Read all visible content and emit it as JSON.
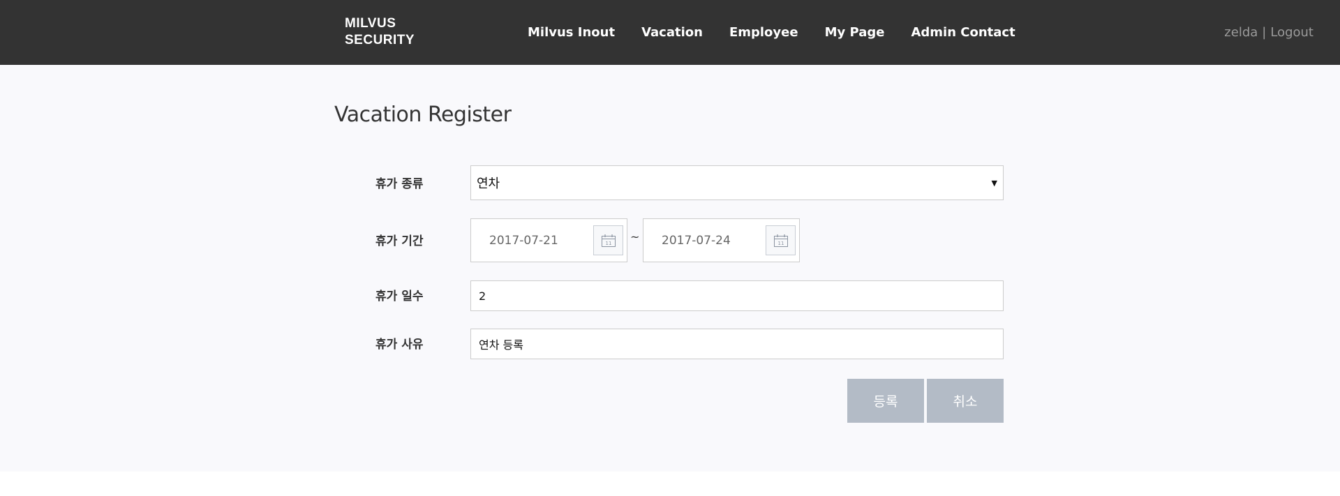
{
  "header": {
    "logo_line1": "MILVUS",
    "logo_line2": "SECURITY",
    "nav": [
      "Milvus Inout",
      "Vacation",
      "Employee",
      "My Page",
      "Admin Contact"
    ],
    "username": "zelda",
    "separator": "|",
    "logout_label": "Logout"
  },
  "page": {
    "title": "Vacation Register"
  },
  "form": {
    "type_label": "휴가 종류",
    "type_value": "연차",
    "period_label": "휴가 기간",
    "start_date": "2017-07-21",
    "end_date": "2017-07-24",
    "range_separator": "~",
    "calendar_day": "11",
    "days_label": "휴가 일수",
    "days_value": "2",
    "reason_label": "휴가 사유",
    "reason_value": "연차 등록"
  },
  "buttons": {
    "register_label": "등록",
    "cancel_label": "취소"
  },
  "colors": {
    "navbar_bg": "#333333",
    "content_bg": "#f9f9fc",
    "button_bg": "#b3bbc6"
  },
  "icons": {
    "calendar": "calendar-icon",
    "dropdown": "dropdown-arrow-icon"
  }
}
